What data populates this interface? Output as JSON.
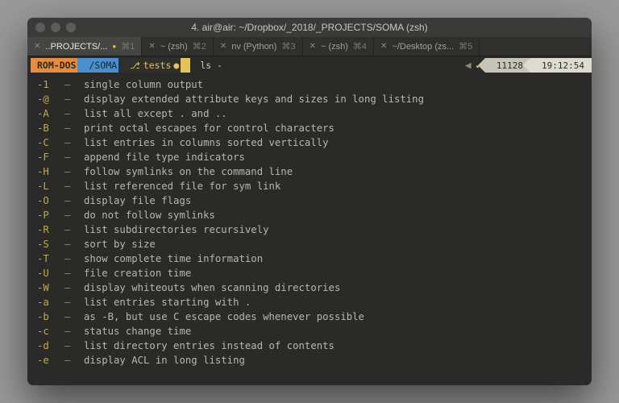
{
  "window": {
    "title": "4. air@air: ~/Dropbox/_2018/_PROJECTS/SOMA (zsh)"
  },
  "tabs": [
    {
      "label": "..PROJECTS/...",
      "hotkey": "⌘1",
      "active": true
    },
    {
      "label": "~ (zsh)",
      "hotkey": "⌘2",
      "active": false
    },
    {
      "label": "nv (Python)",
      "hotkey": "⌘3",
      "active": false
    },
    {
      "label": "~ (zsh)",
      "hotkey": "⌘4",
      "active": false
    },
    {
      "label": "~/Desktop (zs...",
      "hotkey": "⌘5",
      "active": false
    }
  ],
  "prompt": {
    "host": "ROM-DOS",
    "path": "/SOMA",
    "branch_icon": "⎇",
    "branch": "tests",
    "branch_dirty": "●",
    "command": "ls -",
    "exit_ok": "✔",
    "history_num": "11128",
    "clock": "19:12:54"
  },
  "completions": [
    {
      "flag": "-1",
      "desc": "single column output"
    },
    {
      "flag": "-@",
      "desc": "display extended attribute keys and sizes in long listing"
    },
    {
      "flag": "-A",
      "desc": "list all except . and .."
    },
    {
      "flag": "-B",
      "desc": "print octal escapes for control characters"
    },
    {
      "flag": "-C",
      "desc": "list entries in columns sorted vertically"
    },
    {
      "flag": "-F",
      "desc": "append file type indicators"
    },
    {
      "flag": "-H",
      "desc": "follow symlinks on the command line"
    },
    {
      "flag": "-L",
      "desc": "list referenced file for sym link"
    },
    {
      "flag": "-O",
      "desc": "display file flags"
    },
    {
      "flag": "-P",
      "desc": "do not follow symlinks"
    },
    {
      "flag": "-R",
      "desc": "list subdirectories recursively"
    },
    {
      "flag": "-S",
      "desc": "sort by size"
    },
    {
      "flag": "-T",
      "desc": "show complete time information"
    },
    {
      "flag": "-U",
      "desc": "file creation time"
    },
    {
      "flag": "-W",
      "desc": "display whiteouts when scanning directories"
    },
    {
      "flag": "-a",
      "desc": "list entries starting with ."
    },
    {
      "flag": "-b",
      "desc": "as -B, but use C escape codes whenever possible"
    },
    {
      "flag": "-c",
      "desc": "status change time"
    },
    {
      "flag": "-d",
      "desc": "list directory entries instead of contents"
    },
    {
      "flag": "-e",
      "desc": "display ACL in long listing"
    }
  ]
}
